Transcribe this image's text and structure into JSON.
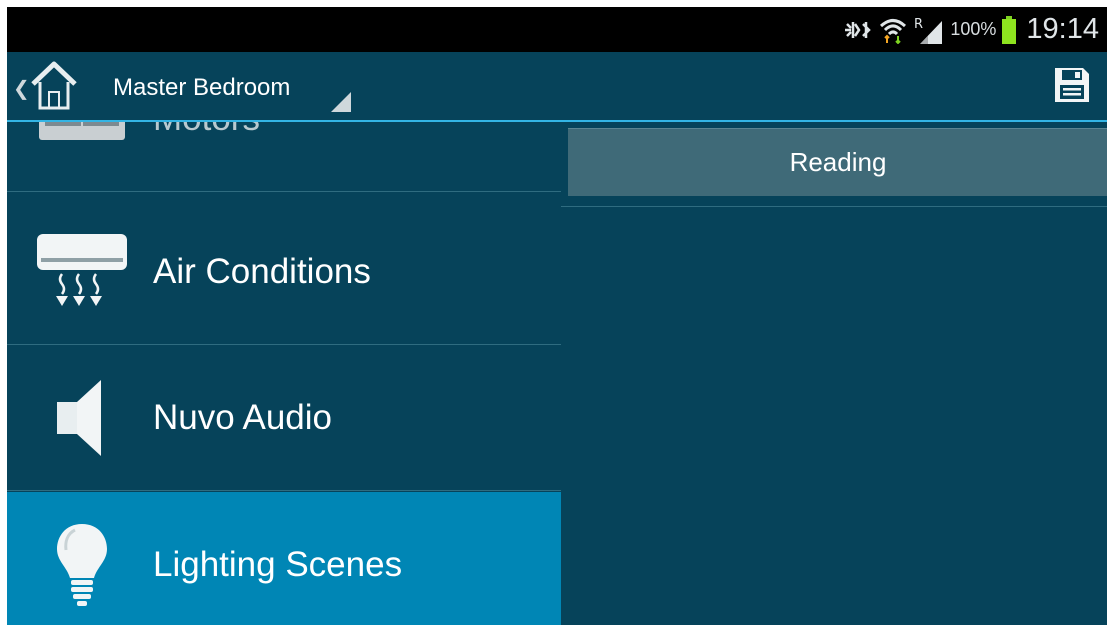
{
  "status_bar": {
    "roaming_indicator": "R",
    "battery_percent": "100%",
    "time": "19:14",
    "icons": [
      "mute-icon",
      "wifi-icon",
      "signal-icon",
      "battery-icon"
    ]
  },
  "action_bar": {
    "room_title": "Master Bedroom",
    "icons": [
      "back-chevron-icon",
      "home-icon",
      "spinner-arrow-icon",
      "save-icon"
    ]
  },
  "categories": [
    {
      "label": "Motors",
      "icon": "motor-icon",
      "state": "partial"
    },
    {
      "label": "Air Conditions",
      "icon": "air-conditioner-icon",
      "state": "normal"
    },
    {
      "label": "Nuvo Audio",
      "icon": "speaker-icon",
      "state": "normal"
    },
    {
      "label": "Lighting Scenes",
      "icon": "light-bulb-icon",
      "state": "selected"
    }
  ],
  "scenes": [
    {
      "label": "Reading"
    }
  ],
  "colors": {
    "background": "#06435a",
    "selected": "#0086b5",
    "accent_line": "#33b5e5",
    "scene_button": "#3f6a78"
  }
}
